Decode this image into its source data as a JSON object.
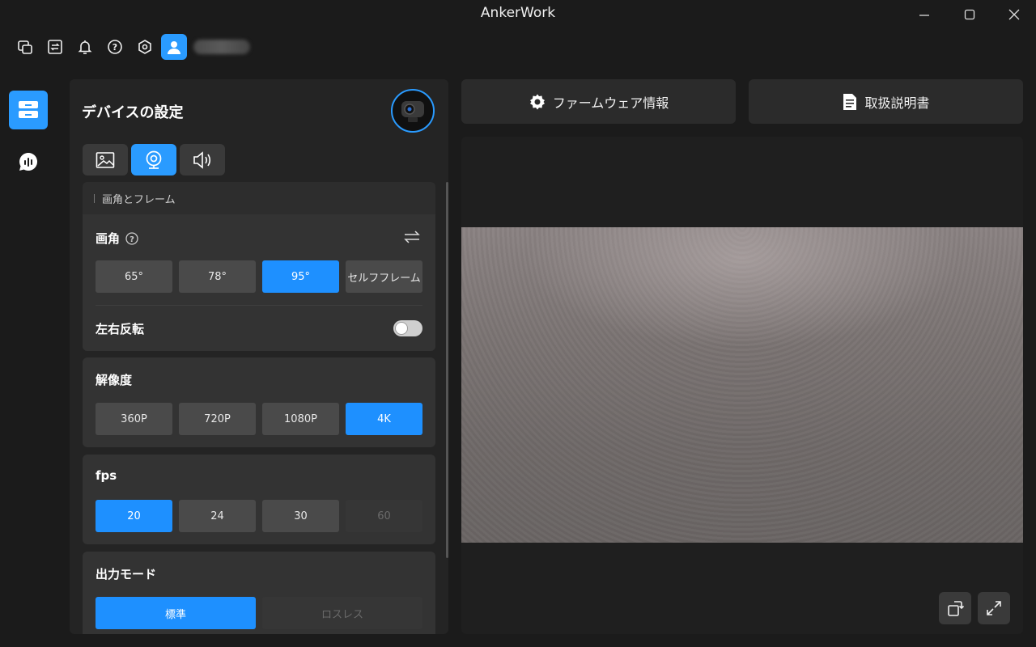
{
  "app": {
    "title": "AnkerWork"
  },
  "toolbar": {
    "icons": [
      "window-switch-icon",
      "swap-icon",
      "bell-icon",
      "help-icon",
      "hexagon-settings-icon"
    ],
    "username": ""
  },
  "nav": {
    "items": [
      "device-settings-icon",
      "audio-wave-icon"
    ]
  },
  "panel": {
    "title": "デバイスの設定",
    "tabs": [
      "image-icon",
      "webcam-icon",
      "speaker-icon"
    ],
    "section_header": "画角とフレーム",
    "fov": {
      "label": "画角",
      "options": [
        "65°",
        "78°",
        "95°",
        "セルフフレーム"
      ],
      "selected": "95°"
    },
    "mirror": {
      "label": "左右反転",
      "on": false
    },
    "resolution": {
      "label": "解像度",
      "options": [
        "360P",
        "720P",
        "1080P",
        "4K"
      ],
      "selected": "4K"
    },
    "fps": {
      "label": "fps",
      "options": [
        "20",
        "24",
        "30",
        "60"
      ],
      "selected": "20",
      "disabled": [
        "60"
      ]
    },
    "output_mode": {
      "label": "出力モード",
      "options": [
        "標準",
        "ロスレス"
      ],
      "selected": "標準",
      "disabled": [
        "ロスレス"
      ]
    }
  },
  "actions": {
    "firmware": "ファームウェア情報",
    "manual": "取扱説明書"
  },
  "colors": {
    "accent": "#2a9bff",
    "panel": "#242424",
    "card": "#2d2d2d",
    "button": "#4a4a4a"
  }
}
